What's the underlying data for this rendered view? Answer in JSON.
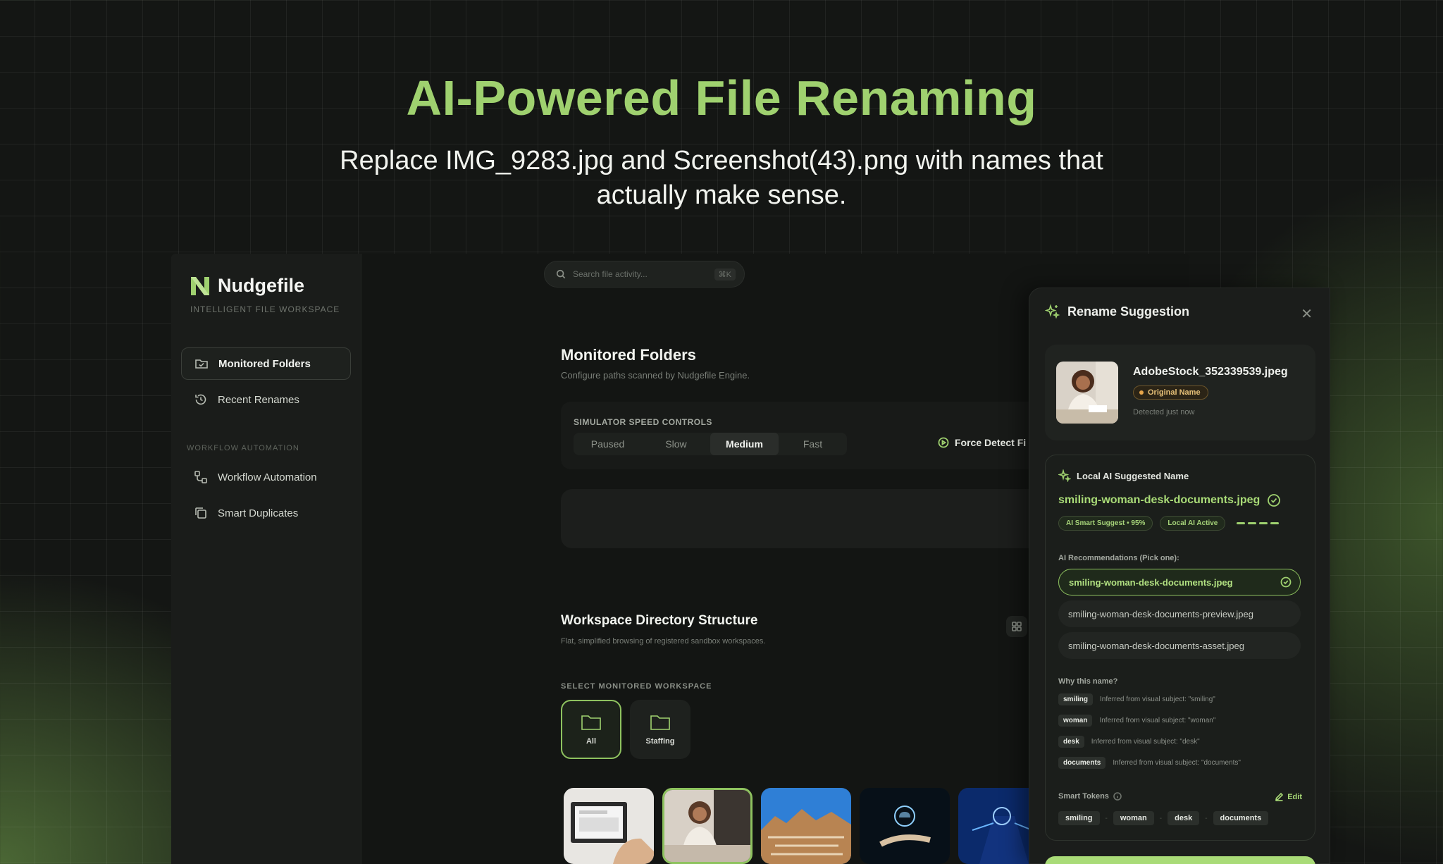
{
  "hero": {
    "title": "AI-Powered File Renaming",
    "subtitle_line1": "Replace IMG_9283.jpg and Screenshot(43).png with names that",
    "subtitle_line2": "actually make sense."
  },
  "sidebar": {
    "brand": "Nudgefile",
    "brand_sub": "INTELLIGENT FILE WORKSPACE",
    "items": [
      {
        "label": "Monitored Folders",
        "icon": "folder-check-icon",
        "active": true
      },
      {
        "label": "Recent Renames",
        "icon": "history-icon",
        "active": false
      }
    ],
    "section": "WORKFLOW AUTOMATION",
    "automation_items": [
      {
        "label": "Workflow Automation",
        "icon": "workflow-icon"
      },
      {
        "label": "Smart Duplicates",
        "icon": "copy-icon"
      }
    ]
  },
  "search": {
    "placeholder": "Search file activity...",
    "shortcut": "⌘K"
  },
  "monitored": {
    "title": "Monitored Folders",
    "subtitle": "Configure paths scanned by Nudgefile Engine.",
    "speed_label": "SIMULATOR SPEED CONTROLS",
    "speeds": [
      "Paused",
      "Slow",
      "Medium",
      "Fast"
    ],
    "active_speed": "Medium",
    "force_detect": "Force Detect Fi"
  },
  "workspace": {
    "title": "Workspace Directory Structure",
    "subtitle": "Flat, simplified browsing of registered sandbox workspaces.",
    "select_label": "SELECT MONITORED WORKSPACE",
    "buttons": [
      "All",
      "Staffing"
    ]
  },
  "panel": {
    "title": "Rename Suggestion",
    "original": {
      "filename": "AdobeStock_352339539.jpeg",
      "badge": "Original Name",
      "detected": "Detected just now"
    },
    "suggested": {
      "header": "Local AI Suggested Name",
      "name": "smiling-woman-desk-documents.jpeg",
      "chip1": "AI Smart Suggest • 95%",
      "chip2": "Local AI Active",
      "rec_label": "AI Recommendations (Pick one):",
      "recommendations": [
        "smiling-woman-desk-documents.jpeg",
        "smiling-woman-desk-documents-preview.jpeg",
        "smiling-woman-desk-documents-asset.jpeg"
      ],
      "why_label": "Why this name?",
      "reasons": [
        {
          "token": "smiling",
          "text": "Inferred from visual subject: \"smiling\""
        },
        {
          "token": "woman",
          "text": "Inferred from visual subject: \"woman\""
        },
        {
          "token": "desk",
          "text": "Inferred from visual subject: \"desk\""
        },
        {
          "token": "documents",
          "text": "Inferred from visual subject: \"documents\""
        }
      ],
      "tokens_label": "Smart Tokens",
      "edit": "Edit",
      "tokens": [
        "smiling",
        "woman",
        "desk",
        "documents"
      ],
      "separator": "-"
    }
  },
  "colors": {
    "accent": "#9fd16f",
    "background": "#141614",
    "badge_amber": "#e8c279"
  }
}
